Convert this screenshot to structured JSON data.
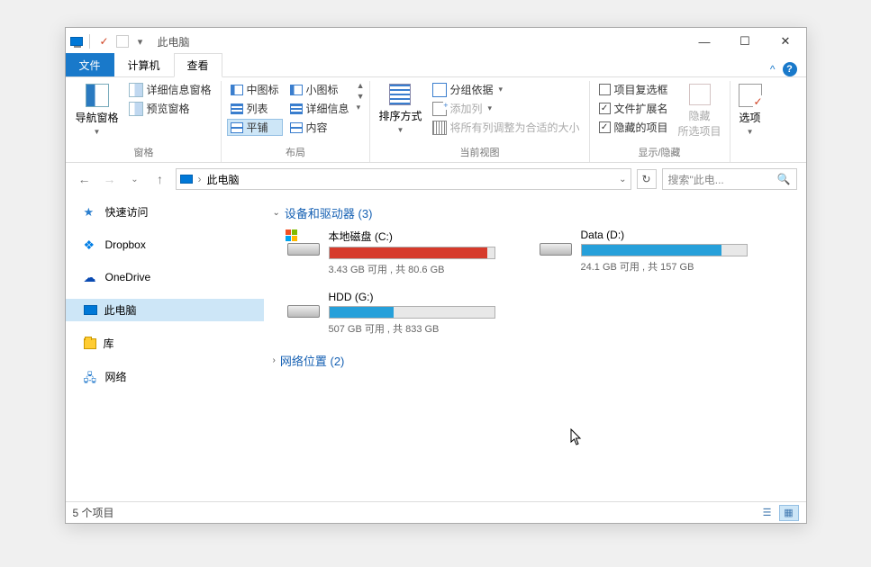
{
  "window": {
    "title": "此电脑"
  },
  "tabs": {
    "file": "文件",
    "computer": "计算机",
    "view": "查看"
  },
  "ribbon": {
    "panes": {
      "nav": "导航窗格",
      "preview": "预览窗格",
      "details": "详细信息窗格",
      "group_label": "窗格"
    },
    "layout": {
      "med_icons": "中图标",
      "sm_icons": "小图标",
      "list": "列表",
      "details": "详细信息",
      "tiles": "平铺",
      "content": "内容",
      "group_label": "布局"
    },
    "current": {
      "sort": "排序方式",
      "group": "分组依据",
      "addcol": "添加列",
      "sizecols": "将所有列调整为合适的大小",
      "group_label": "当前视图"
    },
    "showhide": {
      "itemcheck": "项目复选框",
      "ext": "文件扩展名",
      "hidden": "隐藏的项目",
      "hide_sel": "隐藏\n所选项目",
      "group_label": "显示/隐藏"
    },
    "options": "选项"
  },
  "address": {
    "location": "此电脑"
  },
  "search": {
    "placeholder": "搜索\"此电..."
  },
  "sidebar": {
    "quick": "快速访问",
    "dropbox": "Dropbox",
    "onedrive": "OneDrive",
    "pc": "此电脑",
    "libs": "库",
    "network": "网络"
  },
  "sections": {
    "devices": {
      "label": "设备和驱动器",
      "count": 3
    },
    "netloc": {
      "label": "网络位置",
      "count": 2
    }
  },
  "drives": [
    {
      "name": "本地磁盘 (C:)",
      "stats": "3.43 GB 可用 , 共 80.6 GB",
      "fill_pct": 96,
      "color": "red",
      "winlogo": true
    },
    {
      "name": "Data (D:)",
      "stats": "24.1 GB 可用 , 共 157 GB",
      "fill_pct": 85,
      "color": "blue",
      "winlogo": false
    },
    {
      "name": "HDD (G:)",
      "stats": "507 GB 可用 , 共 833 GB",
      "fill_pct": 39,
      "color": "blue",
      "winlogo": false
    }
  ],
  "status": {
    "items": "5 个项目"
  }
}
